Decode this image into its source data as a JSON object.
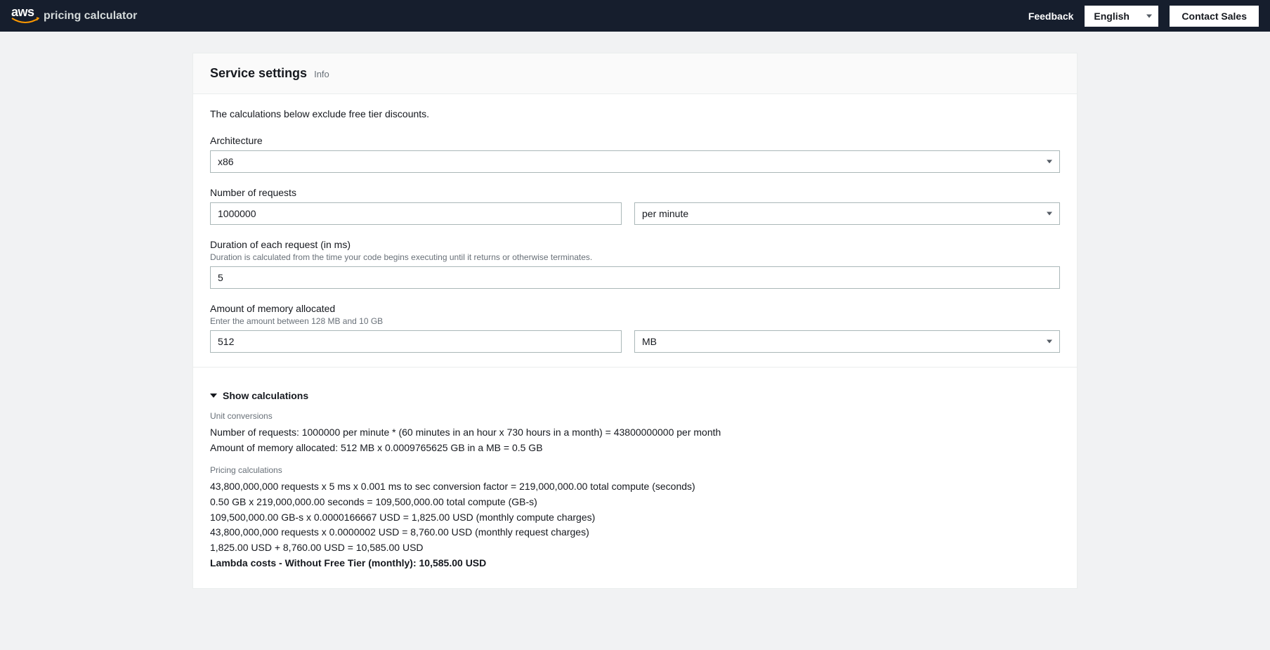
{
  "header": {
    "logo_text": "aws",
    "subheading": "pricing calculator",
    "feedback": "Feedback",
    "language": "English",
    "contact_sales": "Contact Sales"
  },
  "section": {
    "title": "Service settings",
    "info": "Info",
    "notice": "The calculations below exclude free tier discounts."
  },
  "form": {
    "architecture": {
      "label": "Architecture",
      "value": "x86"
    },
    "requests": {
      "label": "Number of requests",
      "value": "1000000",
      "period": "per minute"
    },
    "duration": {
      "label": "Duration of each request (in ms)",
      "hint": "Duration is calculated from the time your code begins executing until it returns or otherwise terminates.",
      "value": "5"
    },
    "memory": {
      "label": "Amount of memory allocated",
      "hint": "Enter the amount between 128 MB and 10 GB",
      "value": "512",
      "unit": "MB"
    }
  },
  "calculations": {
    "toggle": "Show calculations",
    "unit_label": "Unit conversions",
    "unit_lines": [
      "Number of requests: 1000000 per minute * (60 minutes in an hour x 730 hours in a month) = 43800000000 per month",
      "Amount of memory allocated: 512 MB x 0.0009765625 GB in a MB = 0.5 GB"
    ],
    "pricing_label": "Pricing calculations",
    "pricing_lines": [
      "43,800,000,000 requests x 5 ms x 0.001 ms to sec conversion factor = 219,000,000.00 total compute (seconds)",
      "0.50 GB x 219,000,000.00 seconds = 109,500,000.00 total compute (GB-s)",
      "109,500,000.00 GB-s x 0.0000166667 USD = 1,825.00 USD (monthly compute charges)",
      "43,800,000,000 requests x 0.0000002 USD = 8,760.00 USD (monthly request charges)",
      "1,825.00 USD + 8,760.00 USD = 10,585.00 USD"
    ],
    "total": "Lambda costs - Without Free Tier (monthly): 10,585.00 USD"
  }
}
